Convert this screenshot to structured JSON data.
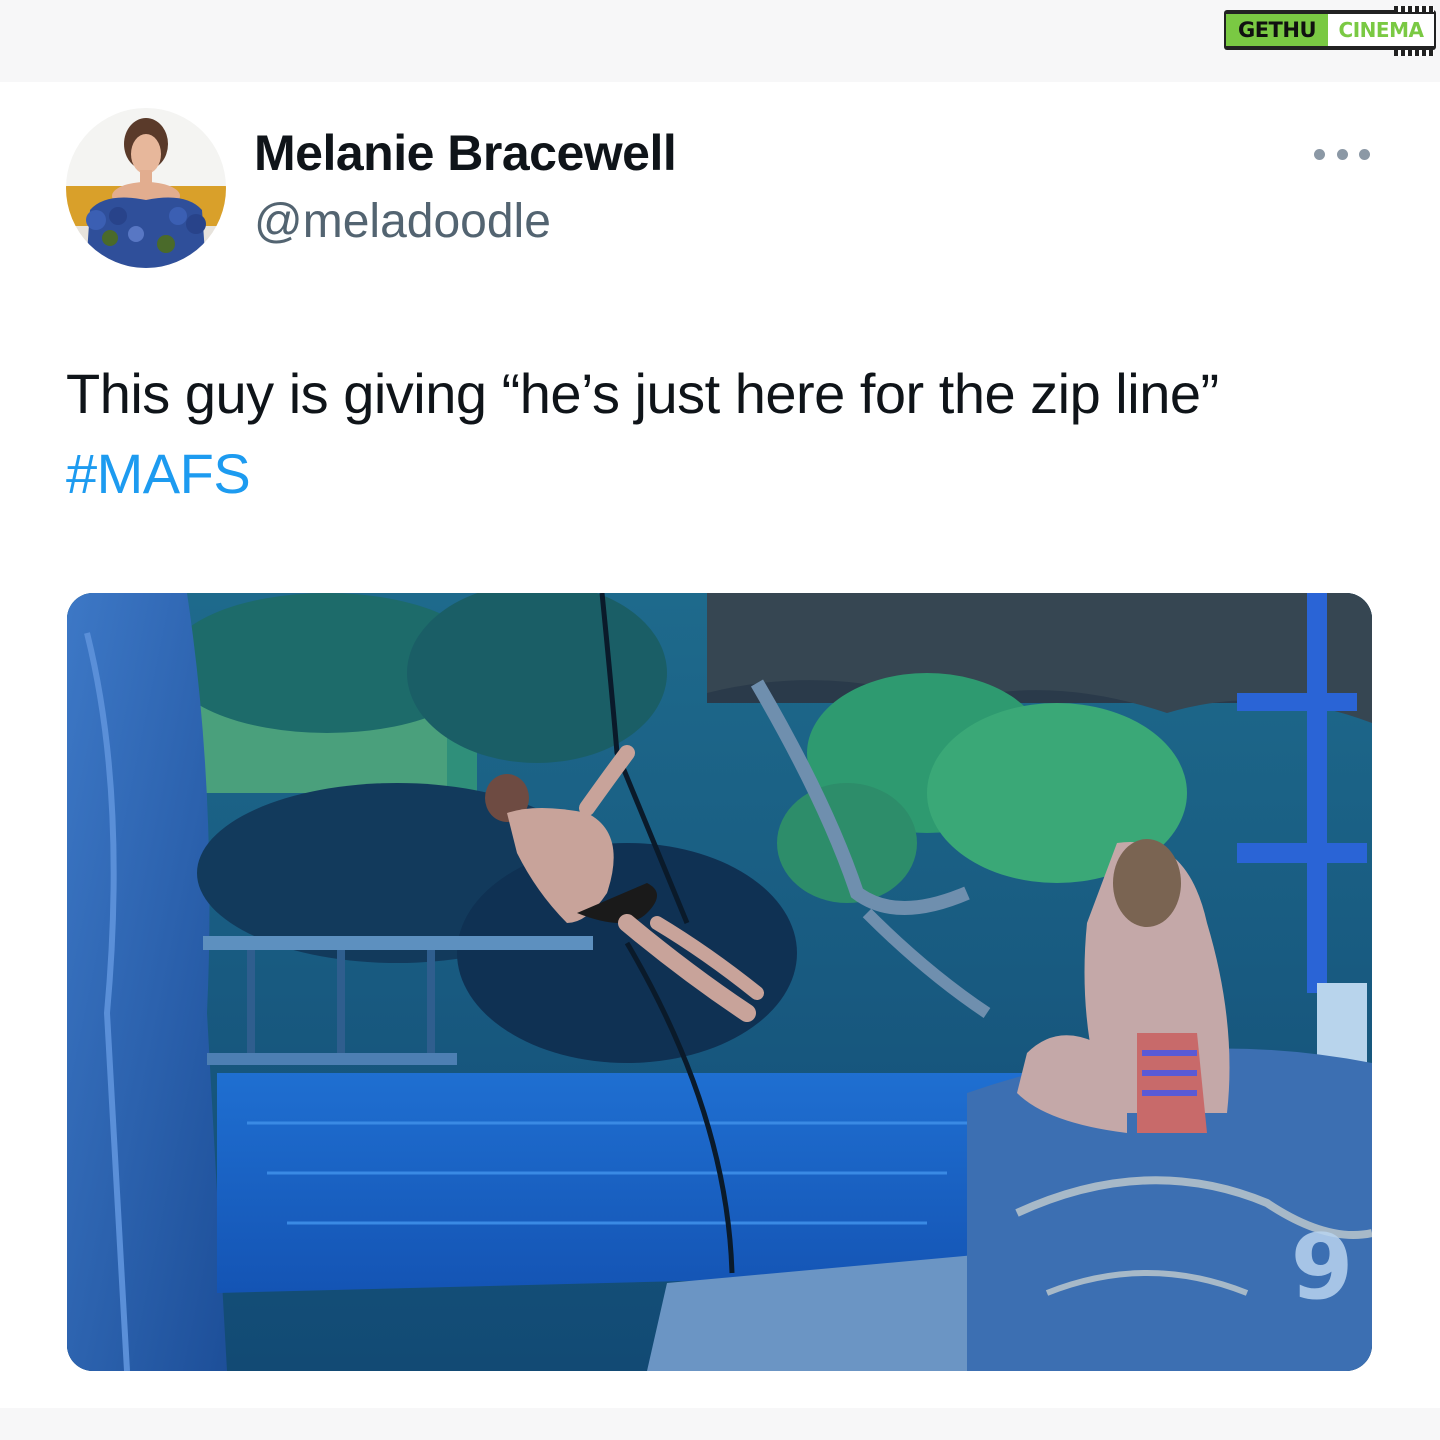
{
  "watermark": {
    "left": "GETHU",
    "right": "CINEMA"
  },
  "tweet": {
    "author": {
      "display_name": "Melanie Bracewell",
      "handle": "@meladoodle"
    },
    "text": "This guy is giving “he’s just here for the zip line”",
    "hashtag": "#MAFS"
  },
  "media": {
    "broadcaster_logo": "9"
  },
  "icons": {
    "more": "more-horizontal-icon"
  }
}
